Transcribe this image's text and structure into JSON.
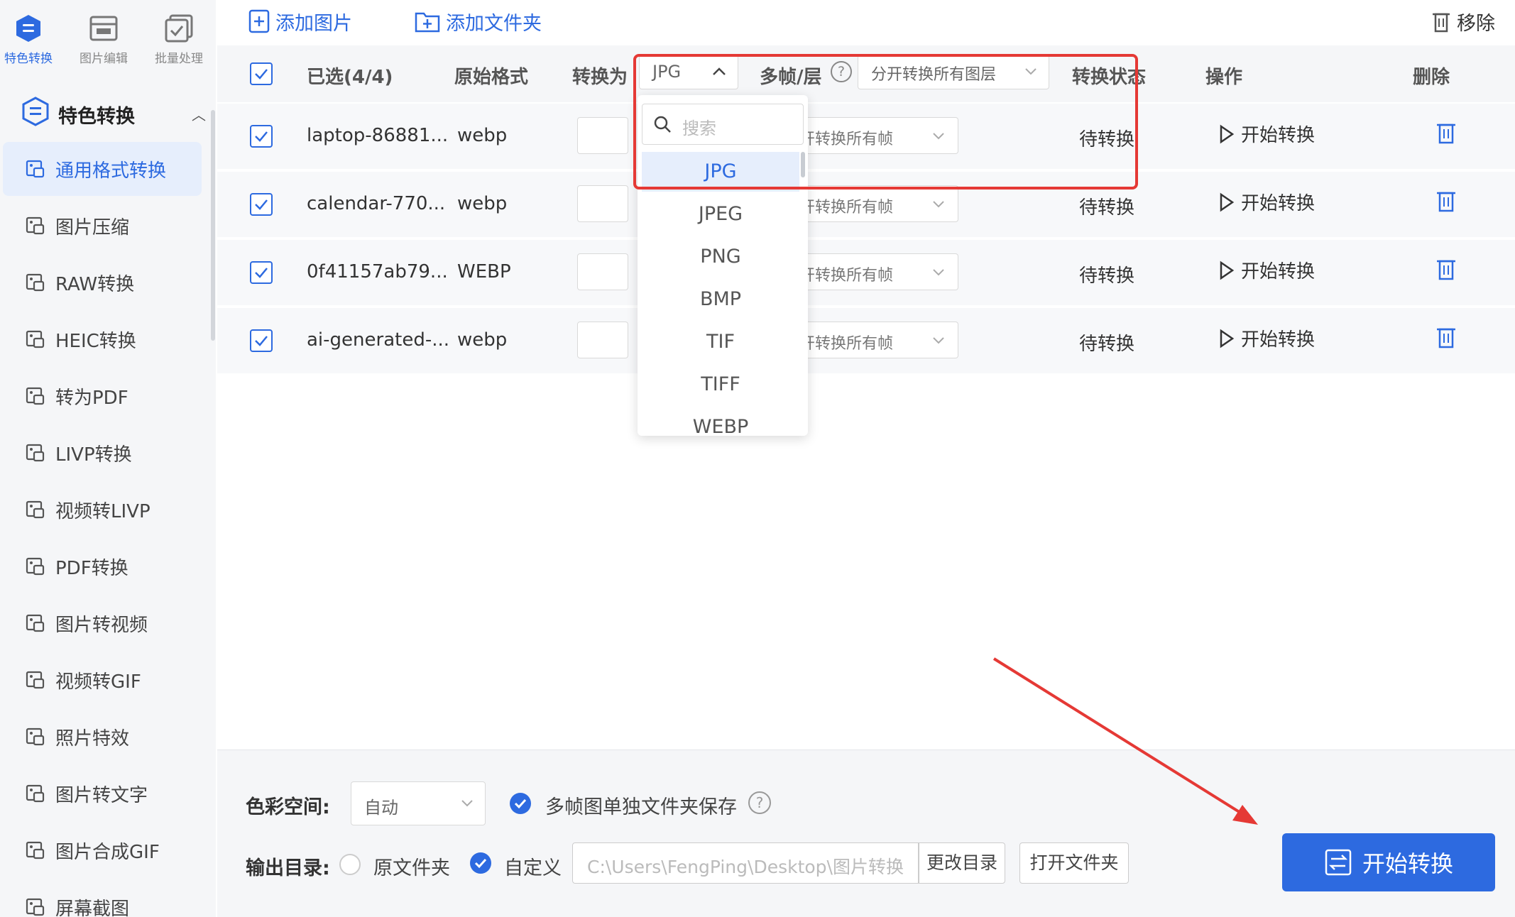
{
  "topnav": [
    {
      "label": "特色转换",
      "icon": "feature-convert-icon",
      "active": true
    },
    {
      "label": "图片编辑",
      "icon": "image-edit-icon",
      "active": false
    },
    {
      "label": "批量处理",
      "icon": "batch-process-icon",
      "active": false
    }
  ],
  "sidebar": {
    "section_title": "特色转换",
    "items": [
      {
        "label": "通用格式转换",
        "icon": "format-convert-icon",
        "active": true
      },
      {
        "label": "图片压缩",
        "icon": "image-compress-icon"
      },
      {
        "label": "RAW转换",
        "icon": "raw-convert-icon"
      },
      {
        "label": "HEIC转换",
        "icon": "heic-convert-icon"
      },
      {
        "label": "转为PDF",
        "icon": "to-pdf-icon"
      },
      {
        "label": "LIVP转换",
        "icon": "livp-convert-icon"
      },
      {
        "label": "视频转LIVP",
        "icon": "video-to-livp-icon"
      },
      {
        "label": "PDF转换",
        "icon": "pdf-convert-icon"
      },
      {
        "label": "图片转视频",
        "icon": "image-to-video-icon"
      },
      {
        "label": "视频转GIF",
        "icon": "video-to-gif-icon"
      },
      {
        "label": "照片特效",
        "icon": "photo-effect-icon"
      },
      {
        "label": "图片转文字",
        "icon": "image-to-text-icon"
      },
      {
        "label": "图片合成GIF",
        "icon": "image-to-gif-icon"
      },
      {
        "label": "屏幕截图",
        "icon": "screenshot-icon"
      }
    ]
  },
  "toolbar": {
    "add_image": "添加图片",
    "add_folder": "添加文件夹",
    "remove": "移除"
  },
  "table": {
    "selected": "已选(4/4)",
    "col_original": "原始格式",
    "col_convert_to": "转换为",
    "convert_to_value": "JPG",
    "col_frames": "多帧/层",
    "frames_value": "分开转换所有图层",
    "col_status": "转换状态",
    "col_action": "操作",
    "col_delete": "删除",
    "rows": [
      {
        "name": "laptop-86881...",
        "format": "webp",
        "frames": "开转换所有帧",
        "status": "待转换",
        "action": "开始转换"
      },
      {
        "name": "calendar-770...",
        "format": "webp",
        "frames": "开转换所有帧",
        "status": "待转换",
        "action": "开始转换"
      },
      {
        "name": "0f41157ab79...",
        "format": "WEBP",
        "frames": "开转换所有帧",
        "status": "待转换",
        "action": "开始转换"
      },
      {
        "name": "ai-generated-...",
        "format": "webp",
        "frames": "开转换所有帧",
        "status": "待转换",
        "action": "开始转换"
      }
    ]
  },
  "dropdown": {
    "search_placeholder": "搜索",
    "options": [
      "JPG",
      "JPEG",
      "PNG",
      "BMP",
      "TIF",
      "TIFF",
      "WEBP"
    ],
    "selected": "JPG"
  },
  "bottom": {
    "color_space_label": "色彩空间:",
    "color_space_value": "自动",
    "multi_frame_label": "多帧图单独文件夹保存",
    "output_label": "输出目录:",
    "original_folder": "原文件夹",
    "custom": "自定义",
    "path": "C:\\Users\\FengPing\\Desktop\\图片转换",
    "change_dir": "更改目录",
    "open_folder": "打开文件夹",
    "start": "开始转换"
  },
  "colors": {
    "accent": "#2d6ae0",
    "highlight_box": "#e53935"
  }
}
